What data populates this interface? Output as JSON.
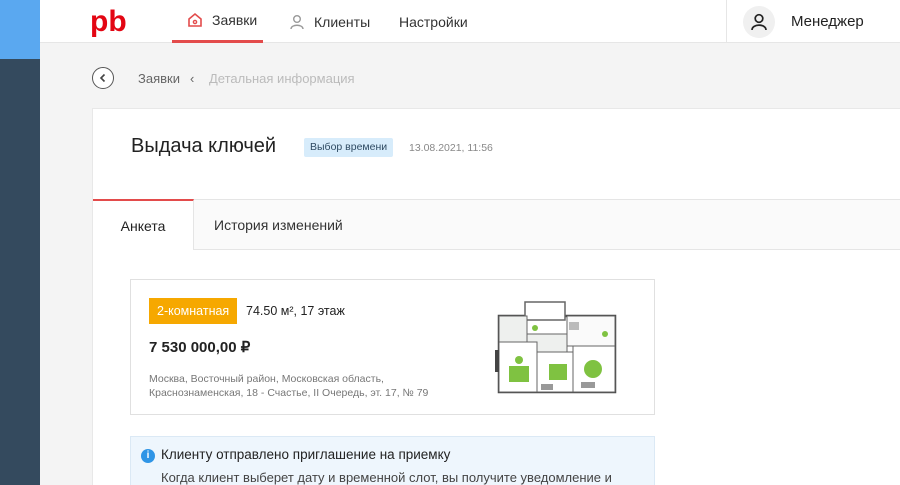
{
  "brand": {
    "logo_text": "pb",
    "logo_color": "#e30613"
  },
  "nav": {
    "items": [
      {
        "label": "Заявки",
        "icon": "home-icon",
        "active": true
      },
      {
        "label": "Клиенты",
        "icon": "person-icon",
        "active": false
      },
      {
        "label": "Настройки",
        "active": false
      }
    ]
  },
  "user": {
    "name": "Менеджер",
    "icon": "user-icon"
  },
  "breadcrumb": {
    "items": [
      "Заявки",
      "Детальная информация"
    ],
    "separator": "‹"
  },
  "page": {
    "title": "Выдача ключей",
    "status": "Выбор времени",
    "timestamp": "13.08.2021, 11:56"
  },
  "tabs": [
    {
      "label": "Анкета",
      "active": true
    },
    {
      "label": "История изменений",
      "active": false
    }
  ],
  "apartment": {
    "rooms": "2-комнатная",
    "area": "74.50 м², 17 этаж",
    "price": "7 530 000,00 ₽",
    "address": "Москва, Восточный район, Московская область, Краснознаменская, 18 - Счастье, II Очередь, эт. 17, № 79"
  },
  "info": {
    "icon": "info-icon",
    "title": "Клиенту отправлено приглашение на приемку",
    "text": "Когда клиент выберет дату и временной слот, вы получите уведомление и"
  },
  "colors": {
    "accent": "#e34b4b",
    "rail": "#344a5e",
    "rail_top": "#5aa8f0",
    "badge_bg": "#d7ecfb",
    "rooms_bg": "#f6a800"
  }
}
